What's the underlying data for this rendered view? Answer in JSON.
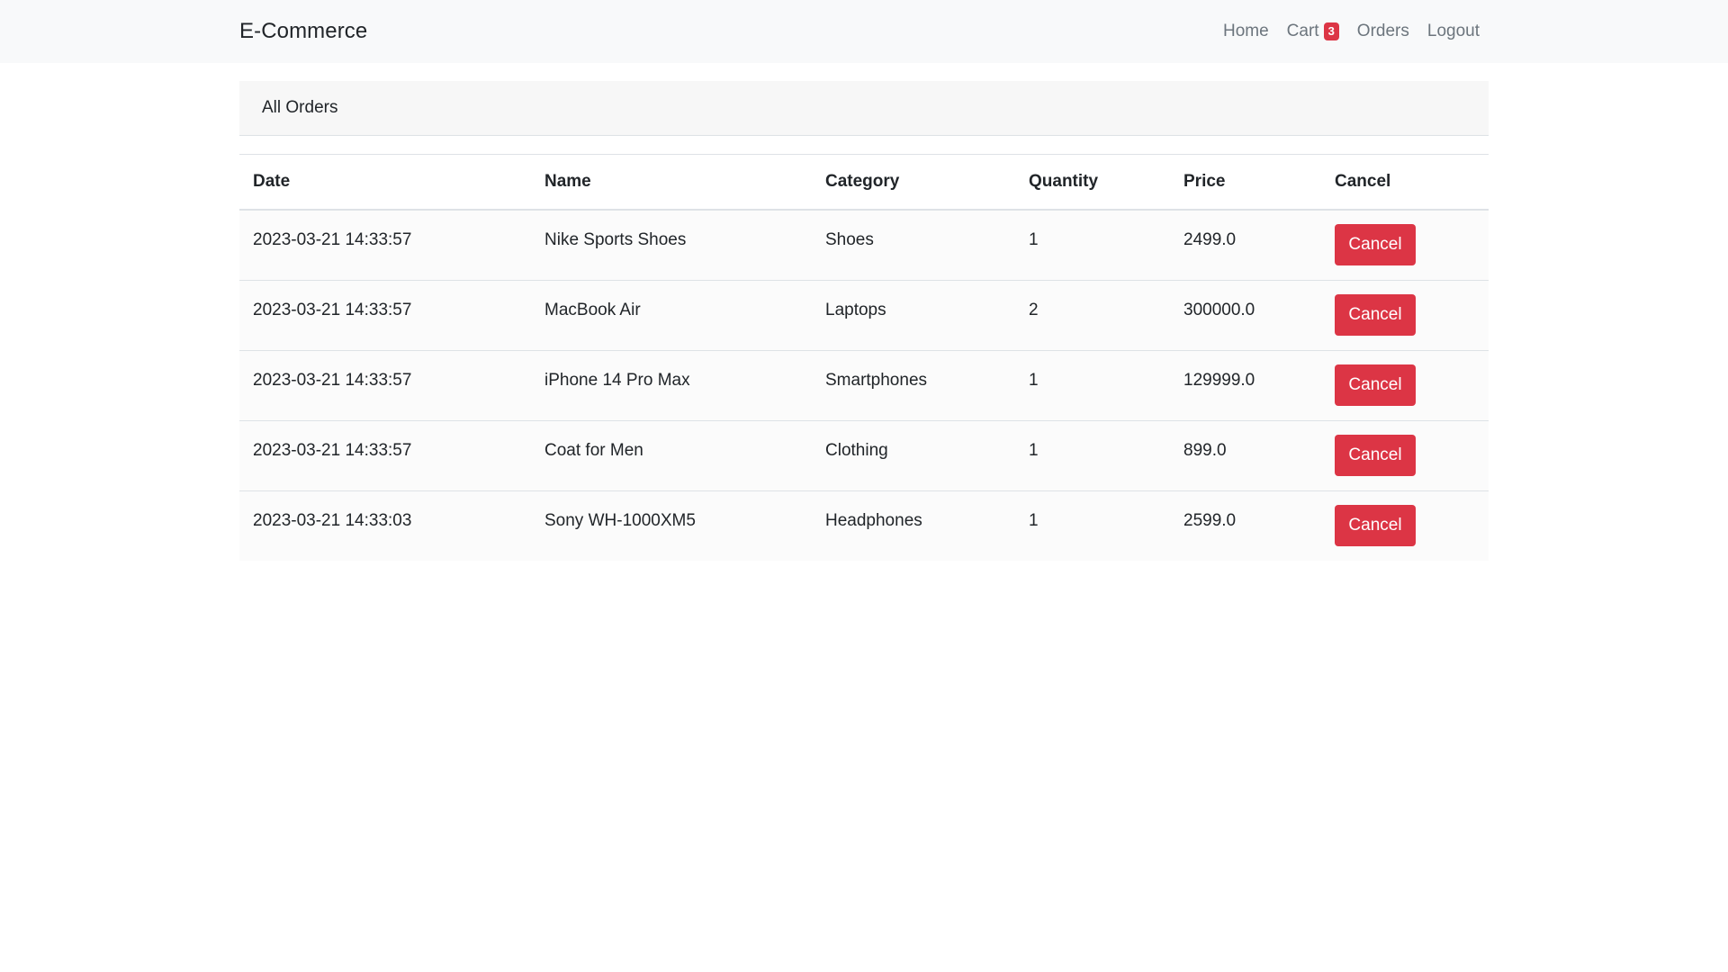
{
  "navbar": {
    "brand": "E-Commerce",
    "links": {
      "home": "Home",
      "cart": "Cart",
      "cart_count": "3",
      "orders": "Orders",
      "logout": "Logout"
    }
  },
  "card": {
    "header": "All Orders"
  },
  "table": {
    "headers": [
      "Date",
      "Name",
      "Category",
      "Quantity",
      "Price",
      "Cancel"
    ],
    "rows": [
      {
        "date": "2023-03-21 14:33:57",
        "name": "Nike Sports Shoes",
        "category": "Shoes",
        "quantity": "1",
        "price": "2499.0",
        "action": "Cancel"
      },
      {
        "date": "2023-03-21 14:33:57",
        "name": "MacBook Air",
        "category": "Laptops",
        "quantity": "2",
        "price": "300000.0",
        "action": "Cancel"
      },
      {
        "date": "2023-03-21 14:33:57",
        "name": "iPhone 14 Pro Max",
        "category": "Smartphones",
        "quantity": "1",
        "price": "129999.0",
        "action": "Cancel"
      },
      {
        "date": "2023-03-21 14:33:57",
        "name": "Coat for Men",
        "category": "Clothing",
        "quantity": "1",
        "price": "899.0",
        "action": "Cancel"
      },
      {
        "date": "2023-03-21 14:33:03",
        "name": "Sony WH-1000XM5",
        "category": "Headphones",
        "quantity": "1",
        "price": "2599.0",
        "action": "Cancel"
      }
    ]
  },
  "colors": {
    "navbar_bg": "#f8f9fa",
    "danger": "#dc3545",
    "muted_link": "#6c757d",
    "card_header_bg": "#f7f7f7"
  }
}
